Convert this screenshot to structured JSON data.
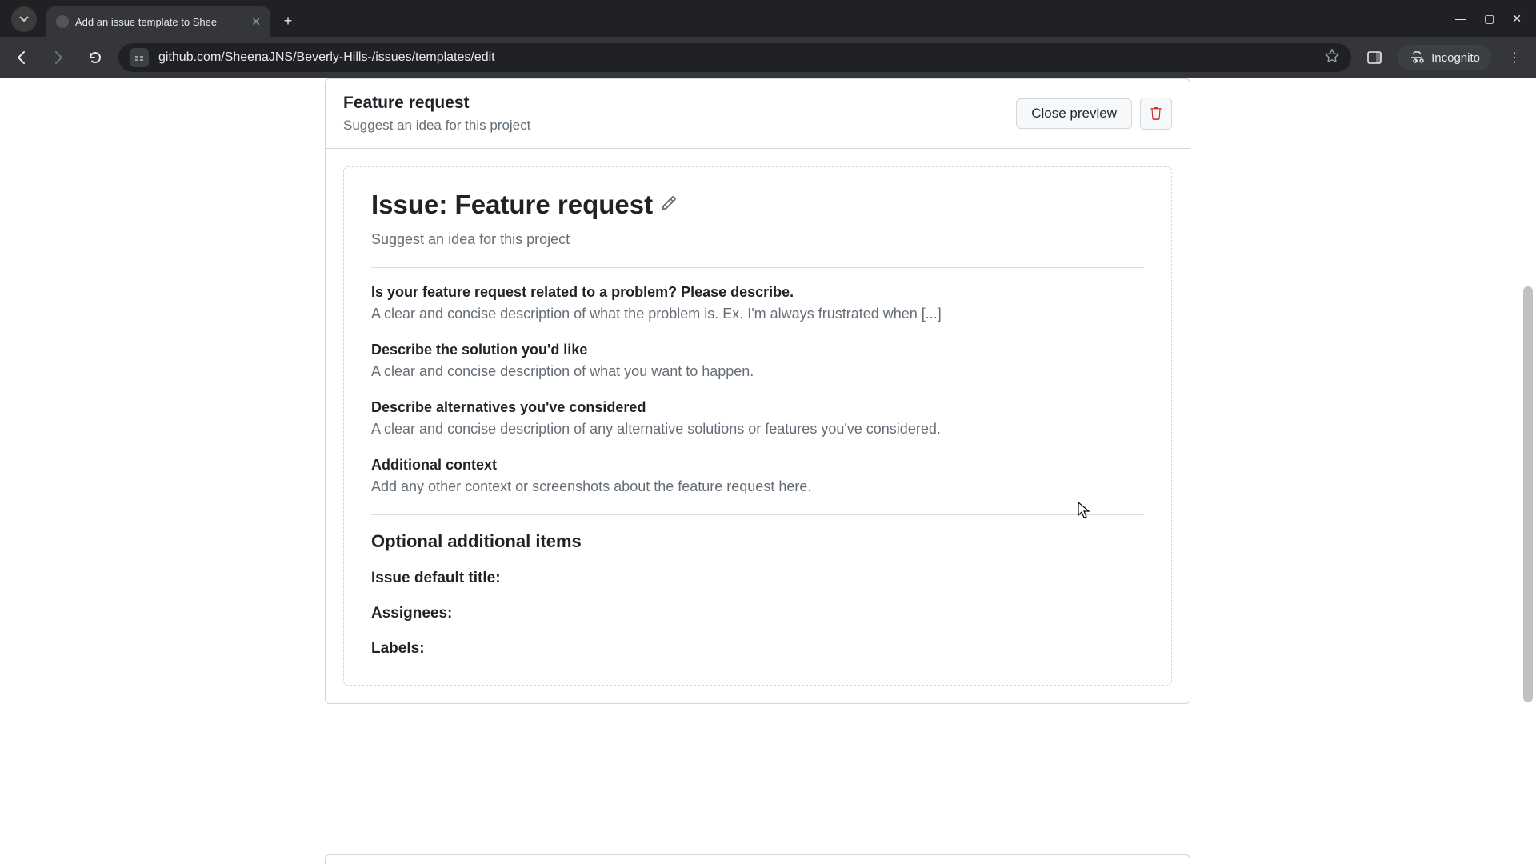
{
  "browser": {
    "tab_title": "Add an issue template to Shee",
    "url": "github.com/SheenaJNS/Beverly-Hills-/issues/templates/edit",
    "incognito_label": "Incognito"
  },
  "card": {
    "title": "Feature request",
    "subtitle": "Suggest an idea for this project",
    "close_preview_label": "Close preview"
  },
  "preview": {
    "issue_title": "Issue: Feature request",
    "issue_subtitle": "Suggest an idea for this project",
    "fields": [
      {
        "q": "Is your feature request related to a problem? Please describe.",
        "a": "A clear and concise description of what the problem is. Ex. I'm always frustrated when [...]"
      },
      {
        "q": "Describe the solution you'd like",
        "a": "A clear and concise description of what you want to happen."
      },
      {
        "q": "Describe alternatives you've considered",
        "a": "A clear and concise description of any alternative solutions or features you've considered."
      },
      {
        "q": "Additional context",
        "a": "Add any other context or screenshots about the feature request here."
      }
    ],
    "optional_heading": "Optional additional items",
    "meta": {
      "default_title_label": "Issue default title:",
      "assignees_label": "Assignees:",
      "labels_label": "Labels:"
    }
  }
}
